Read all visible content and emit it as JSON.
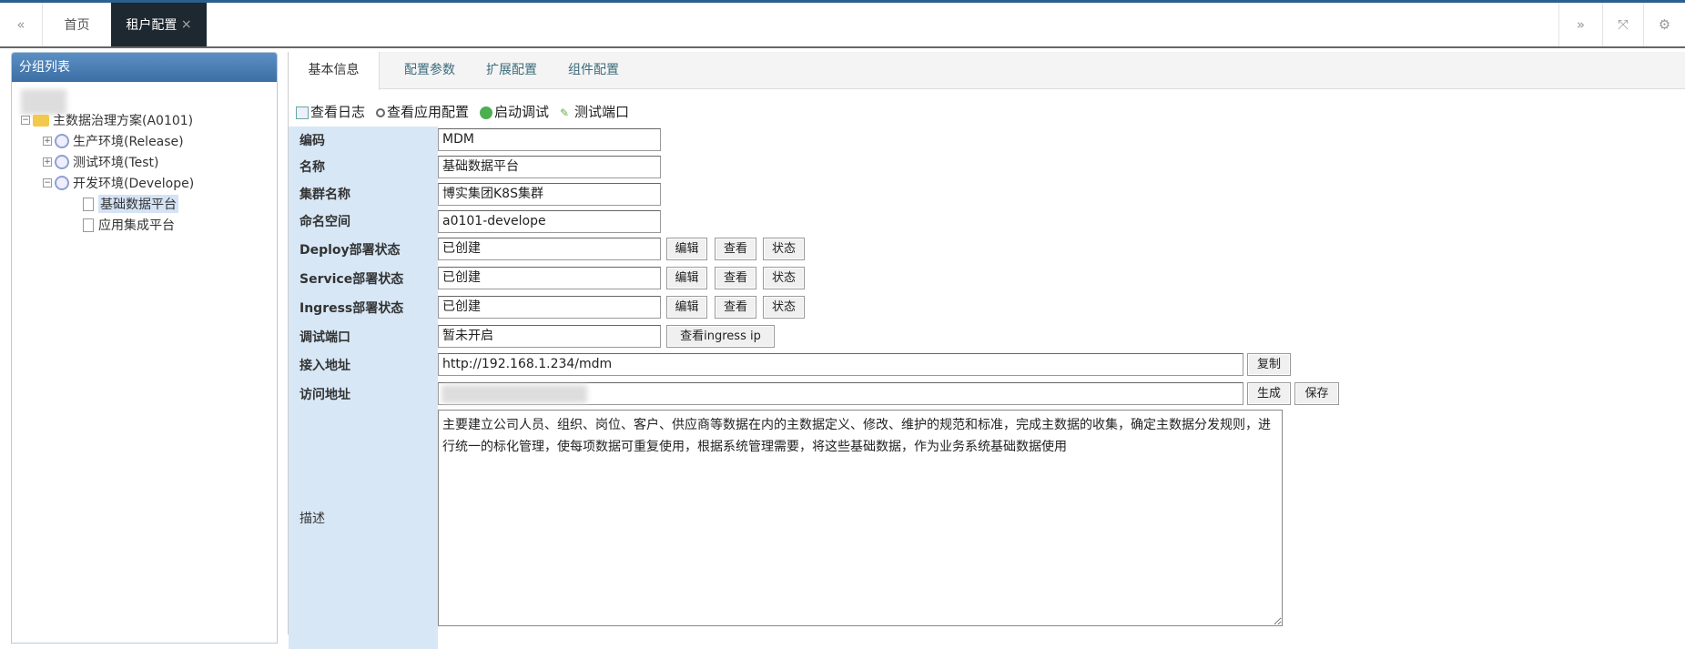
{
  "tabbar": {
    "tabs": [
      {
        "label": "首页"
      },
      {
        "label": "租户配置",
        "close": "×"
      }
    ],
    "icons": {
      "prev": "«",
      "next": "»",
      "fullscreen": "⤧",
      "settings": "⚙"
    }
  },
  "sidebar": {
    "title": "分组列表",
    "tree": {
      "root": "主数据治理方案(A0101)",
      "envs": [
        "生产环境(Release)",
        "测试环境(Test)",
        "开发环境(Develope)"
      ],
      "apps": [
        "基础数据平台",
        "应用集成平台"
      ]
    }
  },
  "main": {
    "tabs": [
      "基本信息",
      "配置参数",
      "扩展配置",
      "组件配置"
    ],
    "toolbar": [
      "查看日志",
      "查看应用配置",
      "启动调试",
      "测试端口"
    ],
    "form": {
      "code": {
        "label": "编码",
        "value": "MDM"
      },
      "name": {
        "label": "名称",
        "value": "基础数据平台"
      },
      "cluster": {
        "label": "集群名称",
        "value": "博实集团K8S集群"
      },
      "namespace": {
        "label": "命名空间",
        "value": "a0101-develope"
      },
      "deploy": {
        "label": "Deploy部署状态",
        "value": "已创建"
      },
      "service": {
        "label": "Service部署状态",
        "value": "已创建"
      },
      "ingress": {
        "label": "Ingress部署状态",
        "value": "已创建"
      },
      "debug_port": {
        "label": "调试端口",
        "value": "暂未开启",
        "button": "查看ingress ip"
      },
      "access_url": {
        "label": "接入地址",
        "value": "http://192.168.1.234/mdm",
        "button": "复制"
      },
      "visit_url": {
        "label": "访问地址",
        "value": "",
        "buttons": [
          "生成",
          "保存"
        ]
      },
      "description": {
        "label": "描述",
        "value": "主要建立公司人员、组织、岗位、客户、供应商等数据在内的主数据定义、修改、维护的规范和标准，完成主数据的收集，确定主数据分发规则，进行统一的标化管理，使每项数据可重复使用，根据系统管理需要，将这些基础数据，作为业务系统基础数据使用"
      }
    },
    "row_buttons": {
      "edit": "编辑",
      "view": "查看",
      "status": "状态"
    }
  }
}
